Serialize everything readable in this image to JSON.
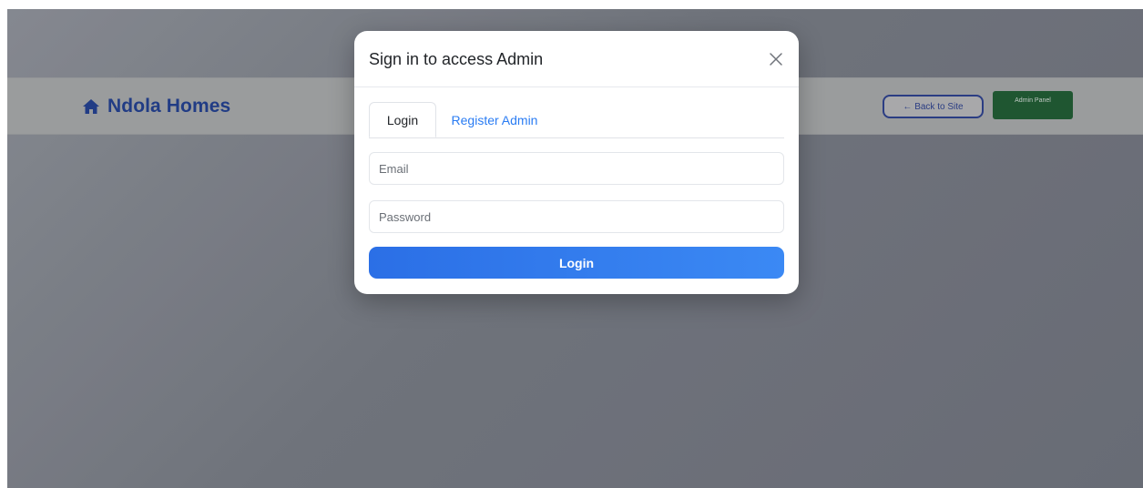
{
  "navbar": {
    "brand_name": "Ndola Homes",
    "brand_icon": "home-icon",
    "back_label": "← Back to Site",
    "admin_panel_label": "Admin Panel"
  },
  "modal": {
    "title": "Sign in to access Admin",
    "close_icon": "close-icon",
    "tabs": [
      {
        "label": "Login",
        "active": true
      },
      {
        "label": "Register Admin",
        "active": false
      }
    ],
    "email": {
      "value": "",
      "placeholder": "Email"
    },
    "password": {
      "value": "",
      "placeholder": "Password"
    },
    "submit_label": "Login"
  },
  "colors": {
    "brand": "#213e8c",
    "primary": "#2b6fe6",
    "admin_green": "#1f5b31",
    "tab_link": "#2a7cf3"
  }
}
